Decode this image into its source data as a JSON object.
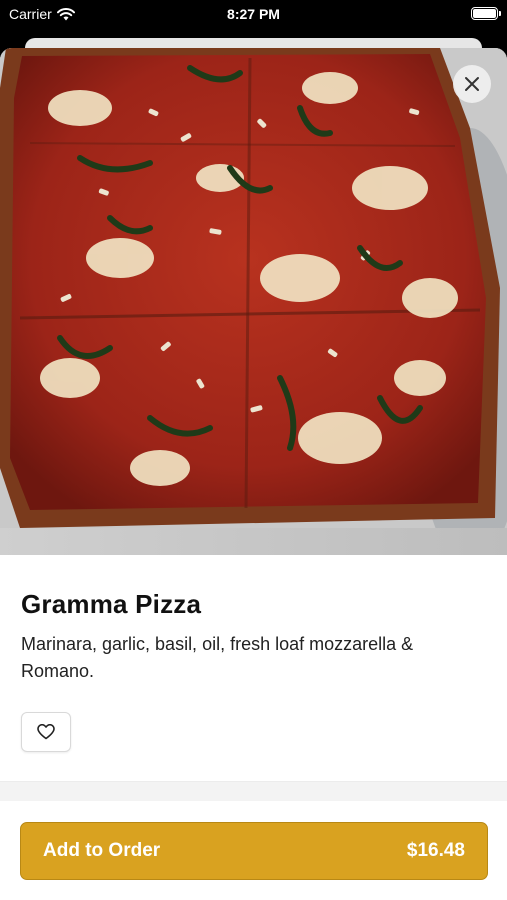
{
  "status_bar": {
    "carrier": "Carrier",
    "time": "8:27 PM"
  },
  "item": {
    "name": "Gramma Pizza",
    "description": "Marinara, garlic, basil, oil, fresh loaf mozzarella & Romano.",
    "image_subject": "square pizza with marinara, garlic, basil and mozzarella"
  },
  "actions": {
    "close_icon": "close-icon",
    "favorite_icon": "heart-outline-icon",
    "add_to_order_label": "Add to Order",
    "price": "$16.48"
  },
  "colors": {
    "accent": "#d9a220",
    "accent_border": "#b88815",
    "sauce": "#a8281c",
    "basil": "#1f3a18"
  }
}
